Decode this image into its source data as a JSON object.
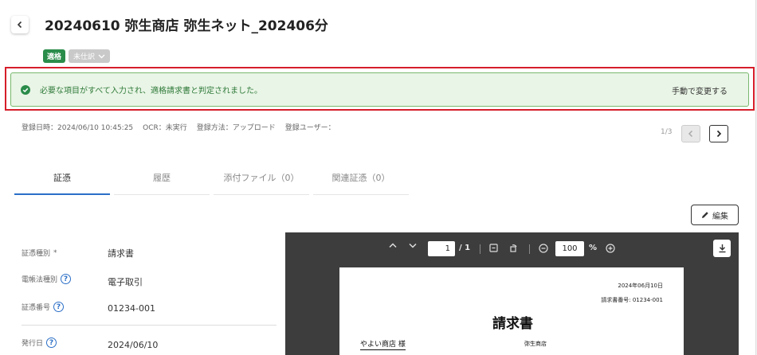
{
  "header": {
    "title": "20240610 弥生商店 弥生ネット_202406分",
    "badge_ok": "適格",
    "badge_status": "未仕訳"
  },
  "alert": {
    "message": "必要な項目がすべて入力され、適格請求書と判定されました。",
    "action": "手動で変更する"
  },
  "meta": {
    "registered_at": "登録日時：2024/06/10 10:45:25",
    "ocr": "OCR：未実行",
    "method": "登録方法：アップロード",
    "user": "登録ユーザー："
  },
  "pager": {
    "position": "1/3"
  },
  "tabs": [
    {
      "label": "証憑"
    },
    {
      "label": "履歴"
    },
    {
      "label": "添付ファイル（0）"
    },
    {
      "label": "関連証憑（0）"
    }
  ],
  "edit_button": "編集",
  "fields": [
    {
      "label": "証憑種別",
      "required": "*",
      "value": "請求書"
    },
    {
      "label": "電帳法種別",
      "value": "電子取引"
    },
    {
      "label": "証憑番号",
      "value": "01234-001"
    },
    {
      "label": "発行日",
      "value": "2024/06/10"
    }
  ],
  "viewer": {
    "page": "1",
    "page_total": "/ 1",
    "zoom": "100",
    "zoom_unit": "%",
    "document": {
      "date": "2024年06月10日",
      "invoice_no": "請求書番号: 01234-001",
      "title": "請求書",
      "recipient": "やよい商店 様",
      "issuer": "弥生商店"
    }
  },
  "colors": {
    "accent": "#2b6fc7",
    "success": "#2a8c4a",
    "highlight": "#d61e2a"
  }
}
